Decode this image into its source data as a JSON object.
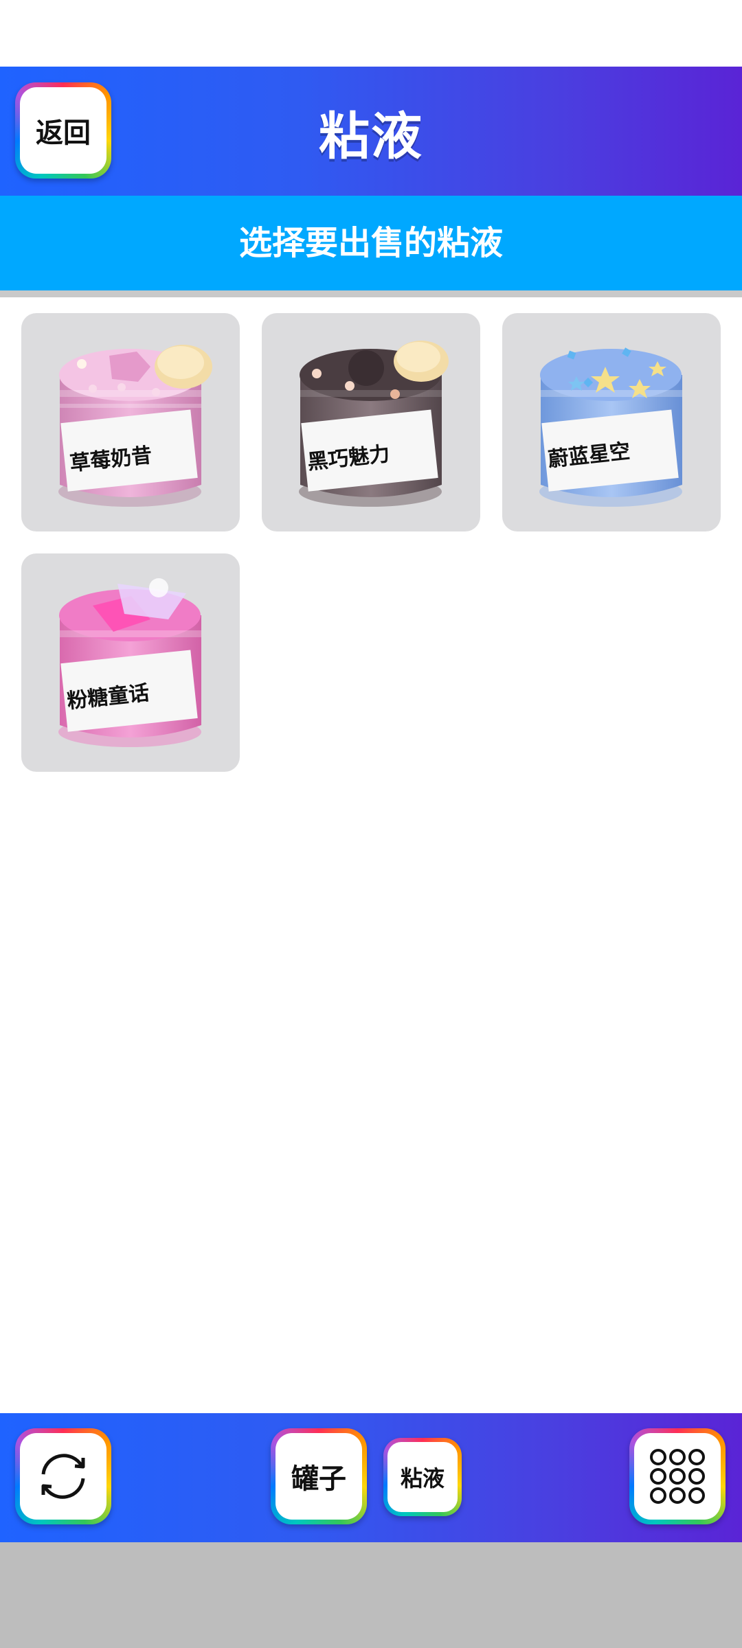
{
  "header": {
    "title": "粘液",
    "back_label": "返回"
  },
  "subheader": {
    "text": "选择要出售的粘液"
  },
  "slimes": [
    {
      "name": "草莓奶昔",
      "color": "#e7a6cf",
      "topping": "strawberry-shake"
    },
    {
      "name": "黑巧魅力",
      "color": "#6d5e62",
      "topping": "dark-chocolate"
    },
    {
      "name": "蔚蓝星空",
      "color": "#8fb2ea",
      "topping": "blue-stars"
    },
    {
      "name": "粉糖童话",
      "color": "#ec7fc2",
      "topping": "pink-candy"
    }
  ],
  "bottom_bar": {
    "refresh_icon": "refresh-icon",
    "jar_label": "罐子",
    "slime_label": "粘液",
    "menu_icon": "grid-dots-icon"
  },
  "colors": {
    "header_gradient_start": "#1f63ff",
    "header_gradient_end": "#5a24d6",
    "subheader_bg": "#00a8ff",
    "card_bg": "#dcdcde"
  }
}
